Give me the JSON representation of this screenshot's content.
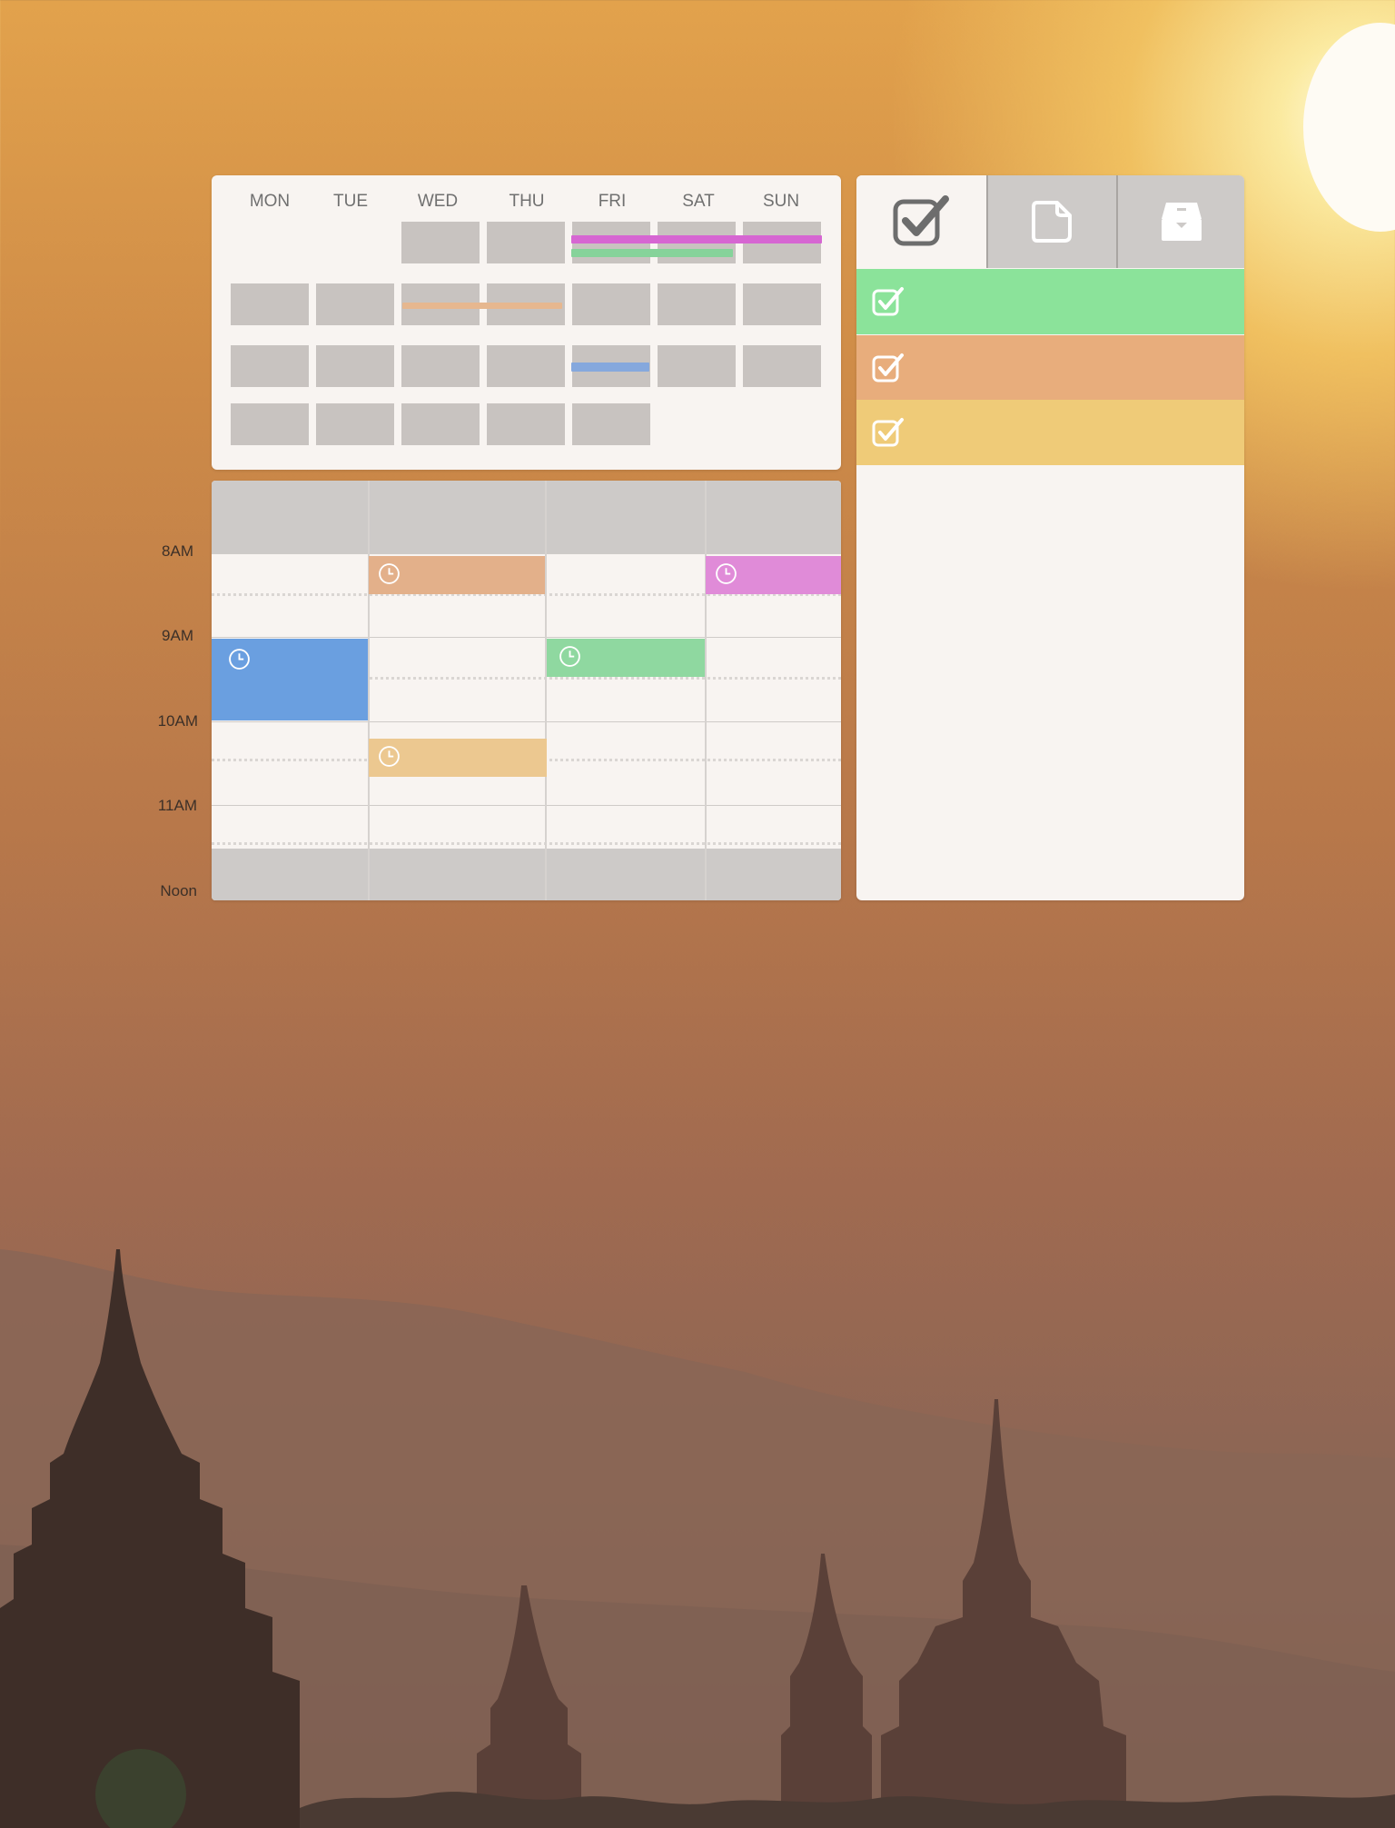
{
  "calendar": {
    "day_headers": [
      "MON",
      "TUE",
      "WED",
      "THU",
      "FRI",
      "SAT",
      "SUN"
    ]
  },
  "week_view": {
    "time_labels": [
      "8AM",
      "9AM",
      "10AM",
      "11AM",
      "Noon"
    ],
    "events": [
      {
        "name": "event-wed-8am",
        "color": "#e3b08a",
        "icon": "clock-icon"
      },
      {
        "name": "event-sun-8am",
        "color": "#e08bd8",
        "icon": "clock-icon"
      },
      {
        "name": "event-mon-9am",
        "color": "#6a9fe0",
        "icon": "clock-icon"
      },
      {
        "name": "event-fri-9am",
        "color": "#8fd8a0",
        "icon": "clock-icon"
      },
      {
        "name": "event-wed-1030am",
        "color": "#ecc890",
        "icon": "clock-icon"
      }
    ]
  },
  "sidebar": {
    "tabs": [
      {
        "name": "tab-tasks",
        "icon": "checkbox-icon",
        "active": true
      },
      {
        "name": "tab-notes",
        "icon": "note-icon",
        "active": false
      },
      {
        "name": "tab-inbox",
        "icon": "inbox-icon",
        "active": false
      }
    ],
    "tasks": [
      {
        "name": "task-green",
        "color": "#8be39a",
        "icon": "checkbox-icon"
      },
      {
        "name": "task-orange",
        "color": "#e8ad7c",
        "icon": "checkbox-icon"
      },
      {
        "name": "task-yellow",
        "color": "#efcb78",
        "icon": "checkbox-icon"
      }
    ]
  },
  "colors": {
    "bar_magenta": "#d666d2",
    "bar_green": "#86d39a",
    "bar_peach": "#e6b78f",
    "bar_blue": "#85a8dd"
  }
}
